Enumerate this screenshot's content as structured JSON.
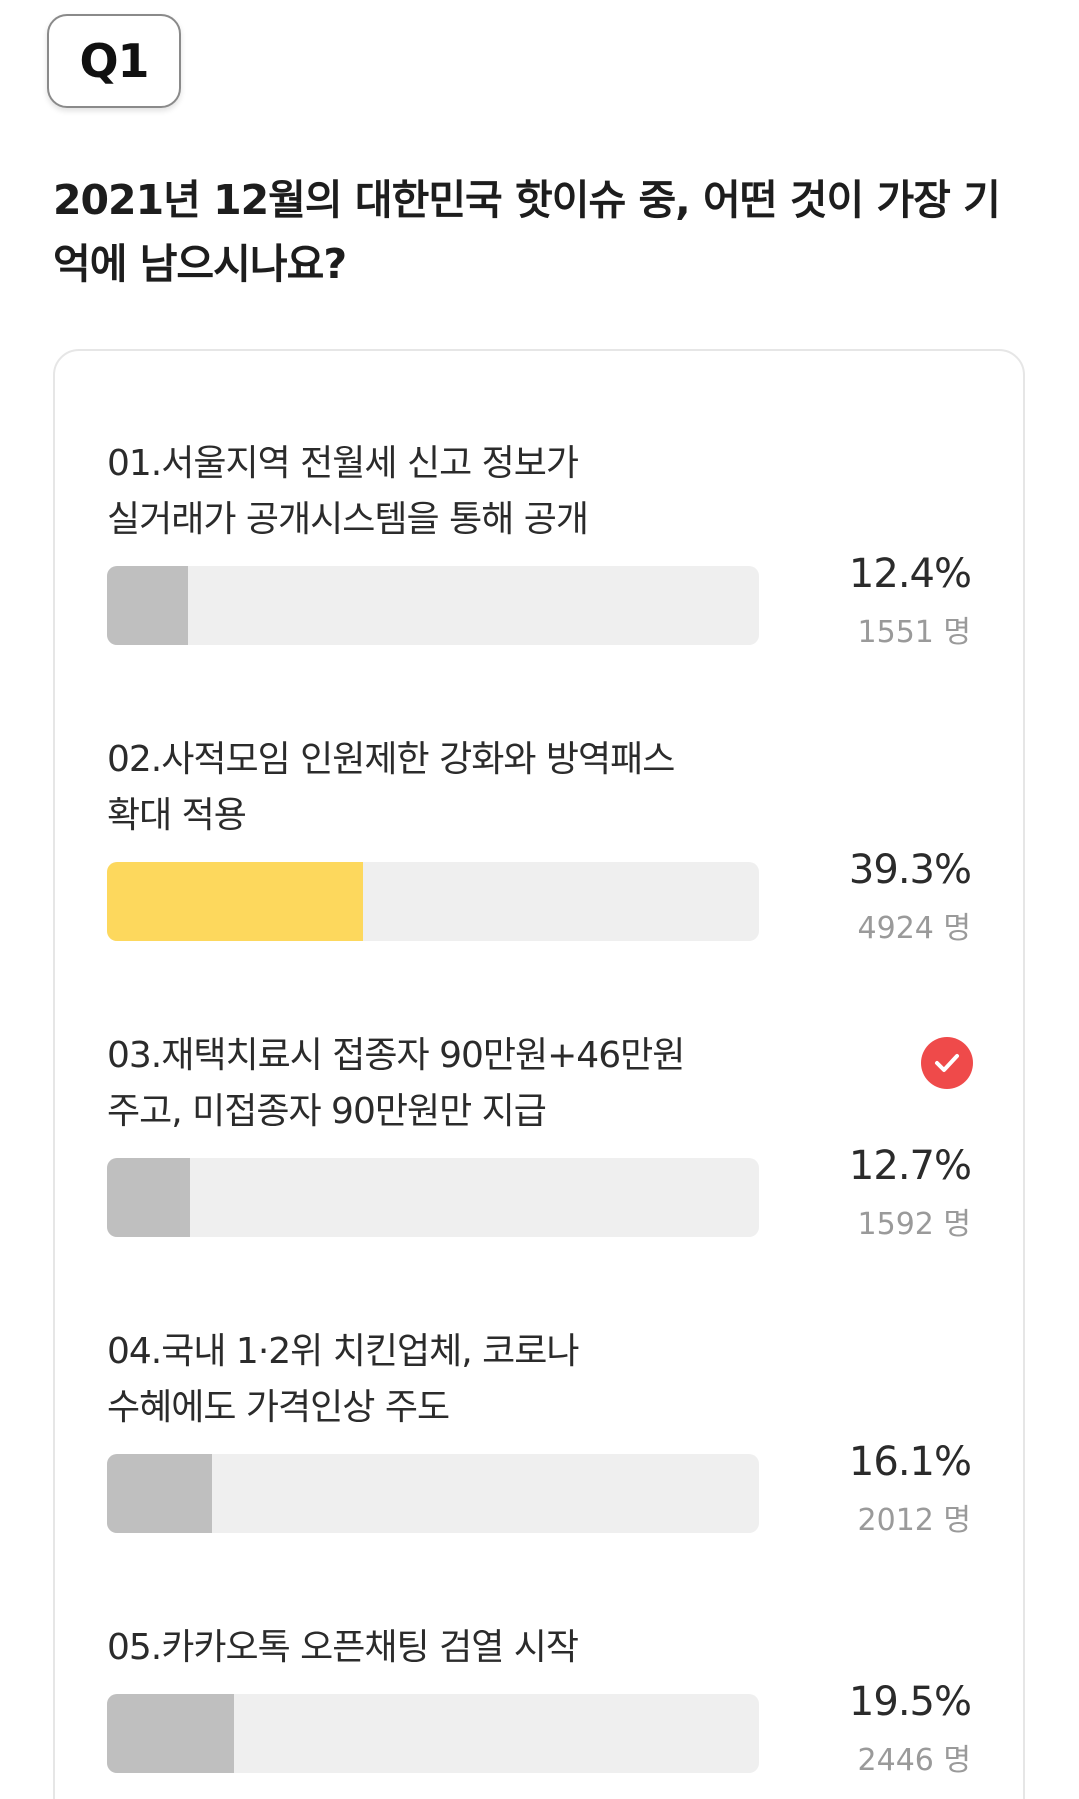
{
  "badge": "Q1",
  "question": "2021년 12월의 대한민국 핫이슈 중, 어떤 것이 가장 기억에 남으시나요?",
  "accent_color": "#fdd85d",
  "check_color": "#ef4a4a",
  "options": [
    {
      "label_line1": "01.서울지역 전월세 신고 정보가",
      "label_line2": "실거래가 공개시스템을 통해 공개",
      "percent_text": "12.4%",
      "percent_value": 12.4,
      "count_text": "1551 명",
      "selected": false,
      "correct": false
    },
    {
      "label_line1": "02.사적모임 인원제한 강화와 방역패스",
      "label_line2": "확대 적용",
      "percent_text": "39.3%",
      "percent_value": 39.3,
      "count_text": "4924 명",
      "selected": true,
      "correct": false
    },
    {
      "label_line1": "03.재택치료시 접종자 90만원+46만원",
      "label_line2": "주고, 미접종자 90만원만 지급",
      "percent_text": "12.7%",
      "percent_value": 12.7,
      "count_text": "1592 명",
      "selected": false,
      "correct": true,
      "icon": "check-icon"
    },
    {
      "label_line1": "04.국내 1·2위 치킨업체, 코로나",
      "label_line2": "수혜에도 가격인상 주도",
      "percent_text": "16.1%",
      "percent_value": 16.1,
      "count_text": "2012 명",
      "selected": false,
      "correct": false
    },
    {
      "label_line1": "05.카카오톡 오픈채팅 검열 시작",
      "label_line2": "",
      "percent_text": "19.5%",
      "percent_value": 19.5,
      "count_text": "2446 명",
      "selected": false,
      "correct": false
    }
  ]
}
